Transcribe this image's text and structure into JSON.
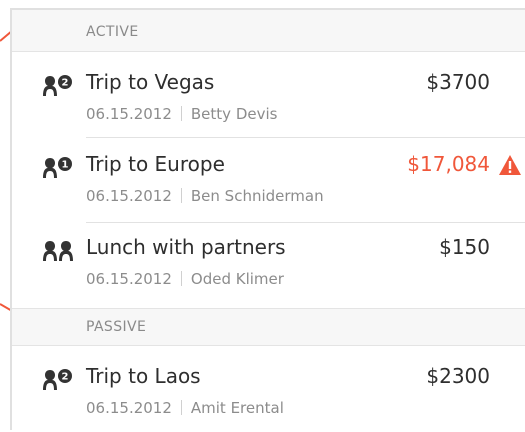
{
  "sections": {
    "active": {
      "label": "ACTIVE"
    },
    "passive": {
      "label": "PASSIVE"
    }
  },
  "trips": [
    {
      "title": "Trip to Vegas",
      "date": "06.15.2012",
      "person": "Betty Devis",
      "amount": "$3700",
      "participants": 2,
      "alert": false
    },
    {
      "title": "Trip to Europe",
      "date": "06.15.2012",
      "person": "Ben Schniderman",
      "amount": "$17,084",
      "participants": 1,
      "alert": true
    },
    {
      "title": "Lunch with partners",
      "date": "06.15.2012",
      "person": "Oded Klimer",
      "amount": "$150",
      "participants": null,
      "alert": false
    },
    {
      "title": "Trip to Laos",
      "date": "06.15.2012",
      "person": "Amit Erental",
      "amount": "$2300",
      "participants": 2,
      "alert": false
    }
  ],
  "colors": {
    "accent": "#f0573a",
    "text": "#2e2e2e",
    "muted": "#8c8c8c",
    "header_bg": "#f7f7f7"
  },
  "icons": {
    "people": "people-icon",
    "warning": "warning-icon"
  }
}
